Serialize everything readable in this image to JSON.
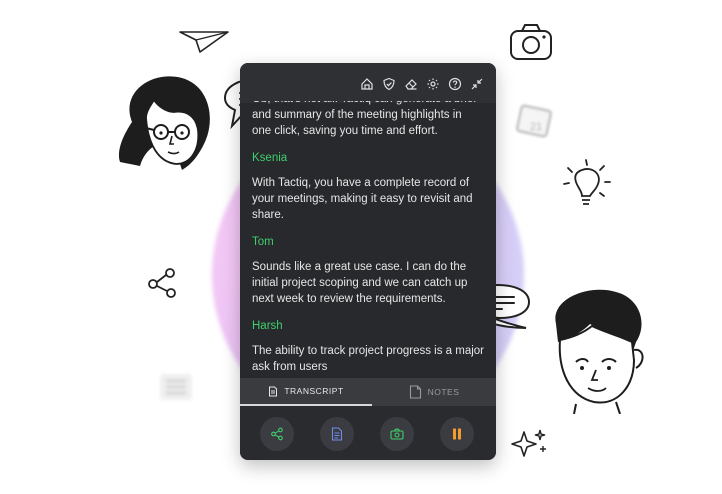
{
  "transcript": [
    {
      "speaker": "",
      "text": "Ob, that's not all! Tactiq can generate a brief and summary of the meeting highlights in one click, saving you time and effort."
    },
    {
      "speaker": "Ksenia",
      "text": "With Tactiq, you have a complete record of your meetings, making it easy to revisit and share."
    },
    {
      "speaker": "Tom",
      "text": "Sounds like a great use case. I can do the initial project scoping and we can catch up next week to review the requirements."
    },
    {
      "speaker": "Harsh",
      "text": "The ability to track project progress is a major ask from users"
    }
  ],
  "tabs": {
    "transcript_label": "TRANSCRIPT",
    "notes_label": "NOTES"
  },
  "colors": {
    "speaker": "#3ecf6a",
    "panel_bg": "#28292d",
    "camera_green": "#3ecf6a",
    "pause_orange": "#f39c2b",
    "doc_blue": "#6f8de8"
  },
  "icons": {
    "toolbar": [
      "home-icon",
      "shield-icon",
      "eraser-icon",
      "gear-icon",
      "help-icon",
      "collapse-icon"
    ],
    "actions": [
      "share-icon",
      "document-icon",
      "camera-icon",
      "pause-icon"
    ]
  }
}
